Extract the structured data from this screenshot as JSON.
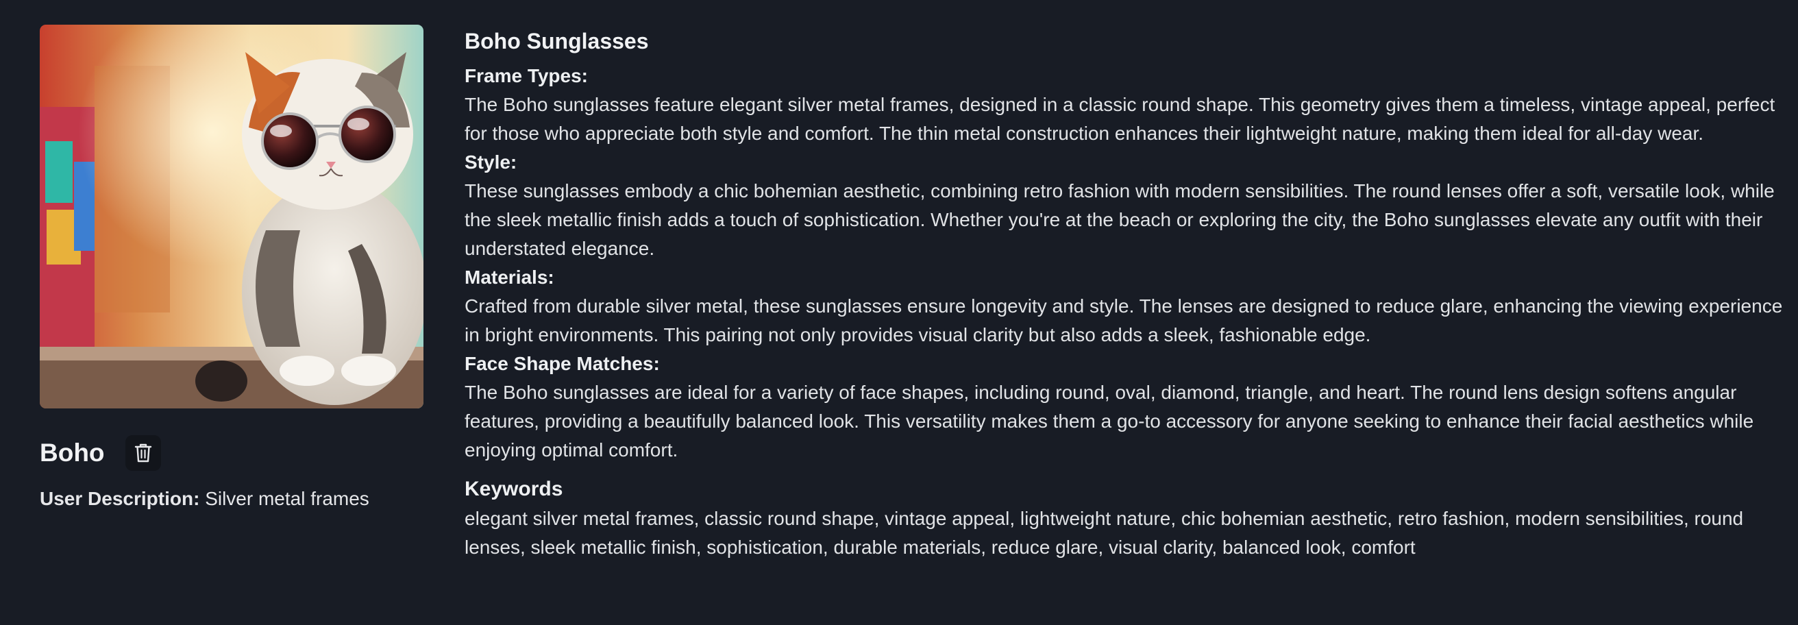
{
  "item": {
    "name": "Boho",
    "user_description_label": "User Description:",
    "user_description": "Silver metal frames",
    "image_icon": "cat-with-sunglasses-photo",
    "delete_icon": "trash-icon"
  },
  "details": {
    "title": "Boho Sunglasses",
    "sections": [
      {
        "heading": "Frame Types:",
        "body": "The Boho sunglasses feature elegant silver metal frames, designed in a classic round shape. This geometry gives them a timeless, vintage appeal, perfect for those who appreciate both style and comfort. The thin metal construction enhances their lightweight nature, making them ideal for all-day wear."
      },
      {
        "heading": "Style:",
        "body": "These sunglasses embody a chic bohemian aesthetic, combining retro fashion with modern sensibilities. The round lenses offer a soft, versatile look, while the sleek metallic finish adds a touch of sophistication. Whether you're at the beach or exploring the city, the Boho sunglasses elevate any outfit with their understated elegance."
      },
      {
        "heading": "Materials:",
        "body": "Crafted from durable silver metal, these sunglasses ensure longevity and style. The lenses are designed to reduce glare, enhancing the viewing experience in bright environments. This pairing not only provides visual clarity but also adds a sleek, fashionable edge."
      },
      {
        "heading": "Face Shape Matches:",
        "body": "The Boho sunglasses are ideal for a variety of face shapes, including round, oval, diamond, triangle, and heart. The round lens design softens angular features, providing a beautifully balanced look. This versatility makes them a go-to accessory for anyone seeking to enhance their facial aesthetics while enjoying optimal comfort."
      }
    ],
    "keywords_heading": "Keywords",
    "keywords": "elegant silver metal frames, classic round shape, vintage appeal, lightweight nature, chic bohemian aesthetic, retro fashion, modern sensibilities, round lenses, sleek metallic finish, sophistication, durable materials, reduce glare, visual clarity, balanced look, comfort"
  },
  "colors": {
    "background": "#181c25",
    "text": "#e6e7ea",
    "button_bg": "#12151b"
  }
}
